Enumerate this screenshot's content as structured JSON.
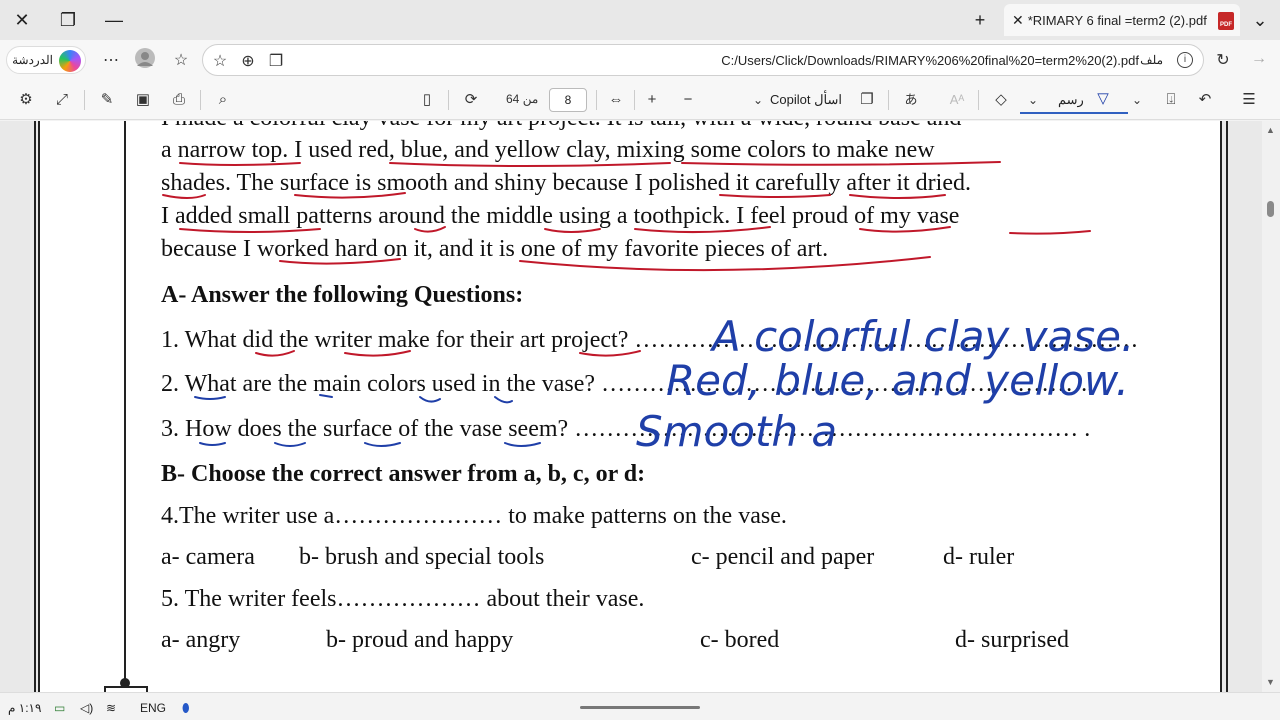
{
  "titlebar": {
    "tab_title": "*RIMARY 6 final =term2 (2).pdf",
    "pdf_badge": "PDF"
  },
  "addressbar": {
    "chat_label": "الدردشة",
    "url": "C:/Users/Click/Downloads/RIMARY%206%20final%20=term2%20(2).pdf",
    "file_label": "ملف"
  },
  "toolbar": {
    "page_current": "8",
    "page_total": "من 64",
    "copilot_label": "Copilot اسأل",
    "draw_label": "رسم"
  },
  "document": {
    "lines": [
      "I made a colorful clay vase for my art project. It is tall, with a wide, round base and",
      "a narrow top. I used red, blue, and yellow clay, mixing some colors to make new",
      "shades. The surface is smooth and shiny because I polished it carefully after it dried.",
      "I added small patterns around the middle using a toothpick. I feel proud of my vase",
      "because I worked hard on it, and it is one of my favorite pieces of art."
    ],
    "section_a": "A- Answer the following Questions:",
    "q1": "1. What did the writer make for their art project?",
    "q1_dots": "………………………………………………………",
    "q2": "2. What are the main colors used in the vase?",
    "q2_dots": "……………………………………………………..",
    "q3": "3. How does the surface of the vase seem?",
    "q3_dots": "……………………………………………………… .",
    "section_b": "B- Choose the correct answer from a, b, c, or d:",
    "q4": "4.The writer use a………………… to make patterns on the vase.",
    "q4_options": [
      "a- camera",
      "b- brush and special tools",
      "c- pencil and paper",
      "d- ruler"
    ],
    "q5": "5. The writer feels………………  about their vase.",
    "q5_options": [
      "a- angry",
      "b-  proud and happy",
      "c-  bored",
      "d- surprised"
    ]
  },
  "handwriting": {
    "a1": "A colorful clay vase.",
    "a2": "Red, blue, and yellow.",
    "a3": "Smooth a",
    "ink_color": "#1f3fa8",
    "underline_color": "#c0182a"
  },
  "taskbar": {
    "time": "١:١٩ م",
    "lang": "ENG"
  }
}
